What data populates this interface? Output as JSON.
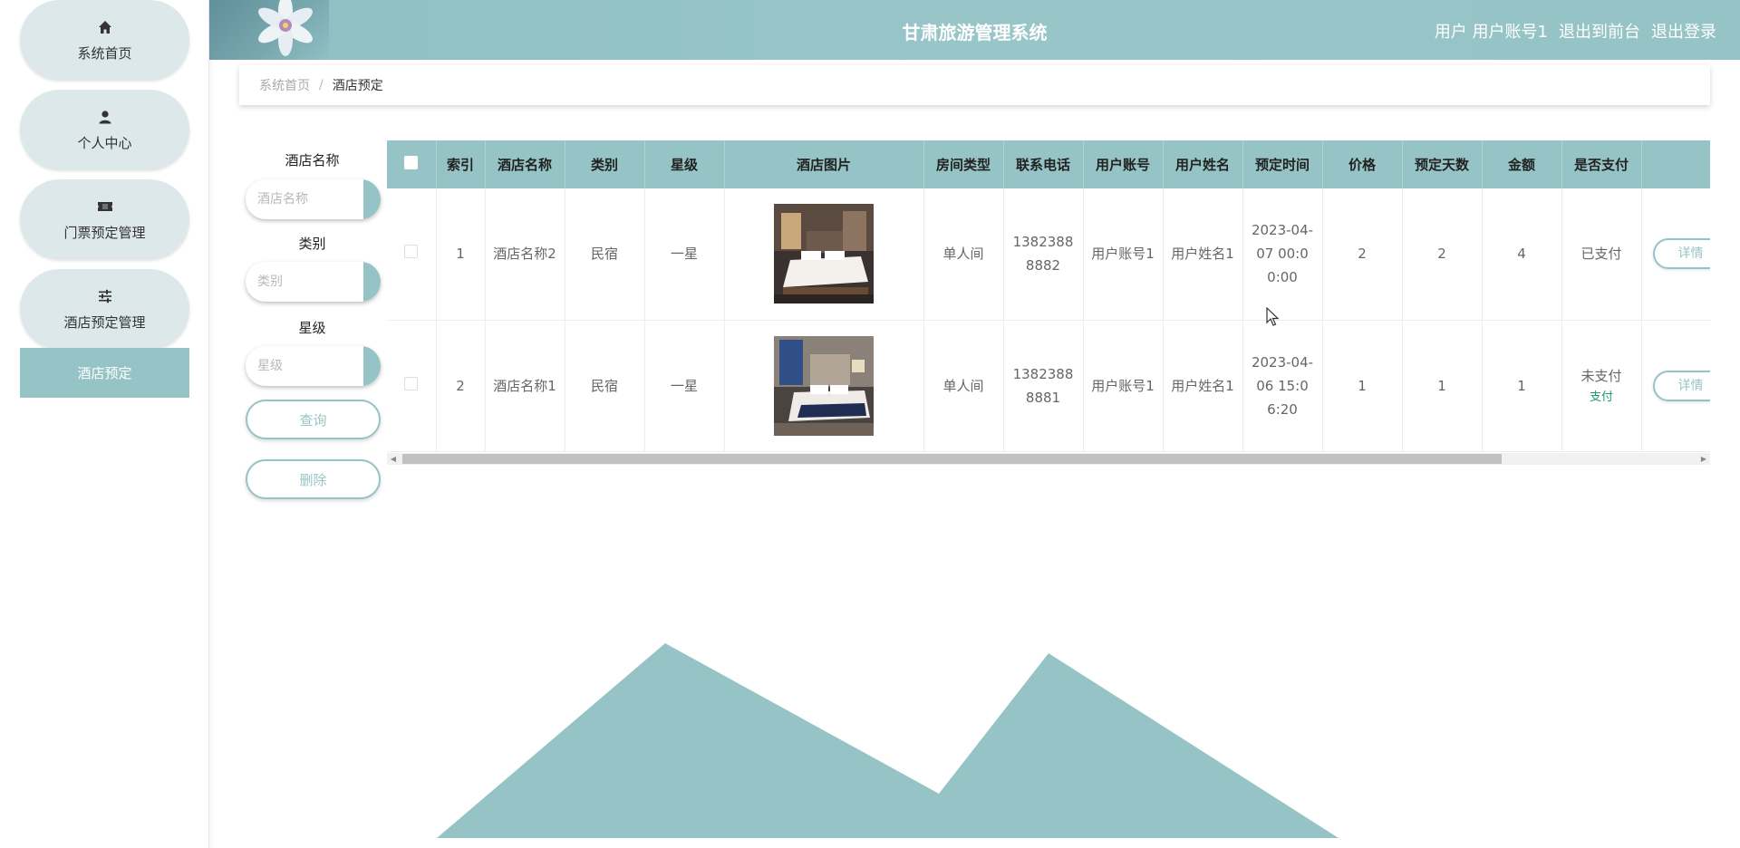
{
  "sidebar": {
    "items": [
      {
        "label": "系统首页",
        "icon": "home-icon"
      },
      {
        "label": "个人中心",
        "icon": "person-icon"
      },
      {
        "label": "门票预定管理",
        "icon": "ticket-icon"
      },
      {
        "label": "酒店预定管理",
        "icon": "sliders-icon"
      }
    ],
    "sub_item": "酒店预定"
  },
  "header": {
    "title": "甘肃旅游管理系统",
    "user_role": "用户",
    "user_name": "用户账号1",
    "to_front": "退出到前台",
    "logout": "退出登录"
  },
  "breadcrumb": {
    "home": "系统首页",
    "separator": "/",
    "current": "酒店预定"
  },
  "search": {
    "hotel_name_label": "酒店名称",
    "hotel_name_placeholder": "酒店名称",
    "category_label": "类别",
    "category_placeholder": "类别",
    "star_label": "星级",
    "star_placeholder": "星级",
    "query_button": "查询",
    "delete_button": "删除"
  },
  "table": {
    "headers": [
      "索引",
      "酒店名称",
      "类别",
      "星级",
      "酒店图片",
      "房间类型",
      "联系电话",
      "用户账号",
      "用户姓名",
      "预定时间",
      "价格",
      "预定天数",
      "金额",
      "是否支付"
    ],
    "rows": [
      {
        "index": "1",
        "hotel_name": "酒店名称2",
        "category": "民宿",
        "star": "一星",
        "room_type": "单人间",
        "phone": "13823888882",
        "account": "用户账号1",
        "user_name": "用户姓名1",
        "time": "2023-04-07 00:00:00",
        "price": "2",
        "days": "2",
        "amount": "4",
        "paid": "已支付",
        "pay_link": "",
        "detail": "详情"
      },
      {
        "index": "2",
        "hotel_name": "酒店名称1",
        "category": "民宿",
        "star": "一星",
        "room_type": "单人间",
        "phone": "13823888881",
        "account": "用户账号1",
        "user_name": "用户姓名1",
        "time": "2023-04-06 15:06:20",
        "price": "1",
        "days": "1",
        "amount": "1",
        "paid": "未支付",
        "pay_link": "支付",
        "detail": "详情"
      }
    ]
  },
  "colors": {
    "accent": "#96c4c6",
    "sidebar_pill": "#dce8ea",
    "pay_link": "#1a9e6e"
  }
}
